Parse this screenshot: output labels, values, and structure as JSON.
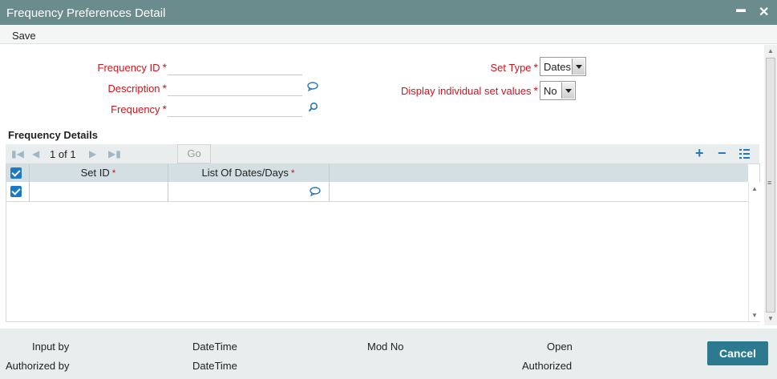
{
  "window": {
    "title": "Frequency Preferences Detail",
    "minimize_label": "▬",
    "close_label": "✕"
  },
  "toolbar": {
    "save_label": "Save"
  },
  "form": {
    "frequency_id": {
      "label": "Frequency ID",
      "value": ""
    },
    "description": {
      "label": "Description",
      "value": ""
    },
    "frequency": {
      "label": "Frequency",
      "value": ""
    },
    "set_type": {
      "label": "Set Type",
      "value": "Dates"
    },
    "display_individual": {
      "label": "Display individual set values",
      "value": "No"
    },
    "required_mark": "*"
  },
  "details": {
    "title": "Frequency Details",
    "page_current": "1",
    "page_of": "of",
    "page_total": "1",
    "go_label": "Go",
    "columns": [
      "Set ID",
      "List Of Dates/Days"
    ],
    "rows": [
      {
        "set_id": "",
        "list_of_dates": ""
      }
    ]
  },
  "footer": {
    "input_by": "Input by",
    "datetime1": "DateTime",
    "mod_no": "Mod No",
    "open": "Open",
    "authorized_by": "Authorized by",
    "datetime2": "DateTime",
    "authorized": "Authorized",
    "cancel_label": "Cancel"
  },
  "colors": {
    "titlebar": "#6b8c8c",
    "required": "#d0141b",
    "accent": "#2a77b7",
    "cancel": "#2b7a8f"
  }
}
